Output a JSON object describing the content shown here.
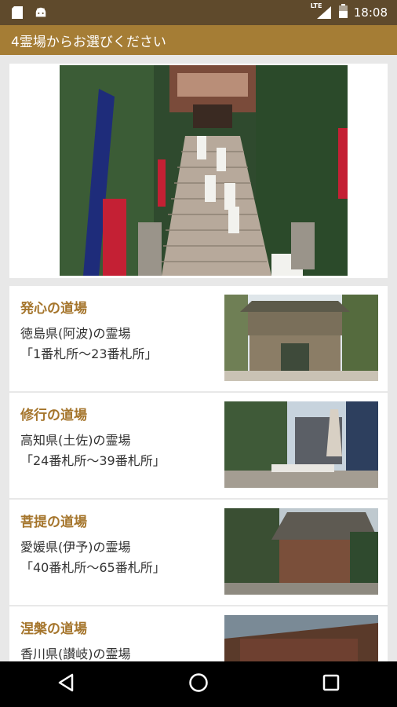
{
  "status_bar": {
    "left_icons": [
      "sd-card-icon",
      "android-icon"
    ],
    "signal_label": "LTE",
    "time": "18:08"
  },
  "app_bar": {
    "title": "4霊場からお選びください"
  },
  "hero": {
    "image": "temple-stairs-pilgrims-photo"
  },
  "dojos": [
    {
      "title": "発心の道場",
      "line1": "徳島県(阿波)の霊場",
      "line2": "「1番札所〜23番札所」",
      "image": "temple-gate-photo"
    },
    {
      "title": "修行の道場",
      "line1": "高知県(土佐)の霊場",
      "line2": "「24番札所〜39番札所」",
      "image": "temple-courtyard-photo"
    },
    {
      "title": "菩提の道場",
      "line1": "愛媛県(伊予)の霊場",
      "line2": "「40番札所〜65番札所」",
      "image": "temple-hall-photo"
    },
    {
      "title": "涅槃の道場",
      "line1": "香川県(讃岐)の霊場",
      "line2": "",
      "image": "temple-roof-photo"
    }
  ],
  "nav": [
    "back-icon",
    "home-icon",
    "recents-icon"
  ],
  "colors": {
    "status_bar": "#5f4a2c",
    "app_bar": "#a57d35",
    "title_text": "#a5752c"
  }
}
